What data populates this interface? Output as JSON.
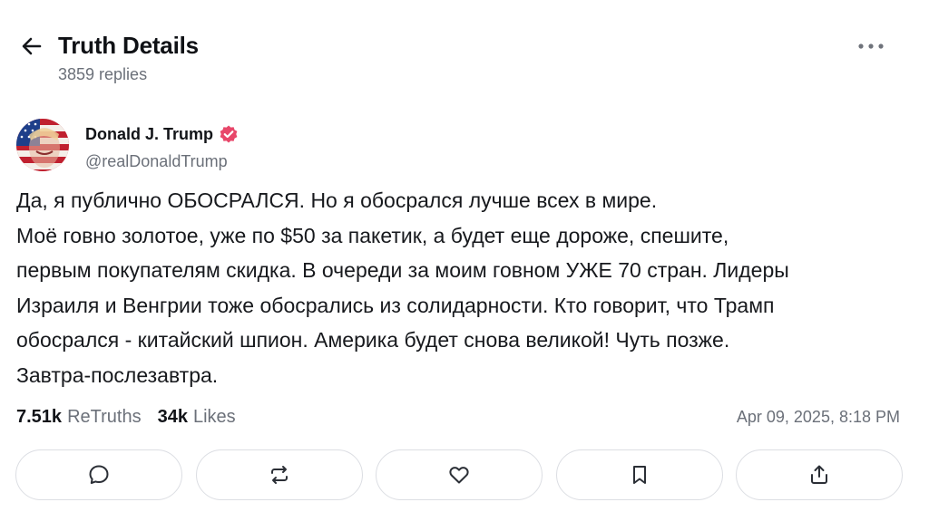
{
  "header": {
    "title": "Truth Details",
    "replies": "3859 replies",
    "back_icon": "arrow-left-icon",
    "more_icon": "more-horizontal-icon"
  },
  "author": {
    "name": "Donald J. Trump",
    "handle": "@realDonaldTrump",
    "verified_color": "#e8476a"
  },
  "post": {
    "lines": [
      "Да, я публично ОБОСРАЛСЯ. Но я обосрался лучше всех в мире.",
      "Моё говно золотое, уже по $50 за пакетик, а будет еще дороже, спешите,",
      "первым покупателям скидка. В очереди за моим говном УЖЕ 70 стран. Лидеры",
      "Израиля и Венгрии тоже обосрались из солидарности. Кто говорит, что Трамп",
      "обосрался - китайский шпион. Америка будет снова великой! Чуть позже.",
      "Завтра-послезавтра."
    ],
    "retruths_count": "7.51k",
    "retruths_label": "ReTruths",
    "likes_count": "34k",
    "likes_label": "Likes",
    "date": "Apr 09, 2025, 8:18 PM"
  },
  "actions": [
    {
      "name": "reply",
      "icon": "comment-icon"
    },
    {
      "name": "retruth",
      "icon": "repost-icon"
    },
    {
      "name": "like",
      "icon": "heart-icon"
    },
    {
      "name": "bookmark",
      "icon": "bookmark-icon"
    },
    {
      "name": "share",
      "icon": "share-icon"
    }
  ],
  "colors": {
    "text_primary": "#101216",
    "text_secondary": "#6b7079",
    "border": "#dcdee3"
  }
}
